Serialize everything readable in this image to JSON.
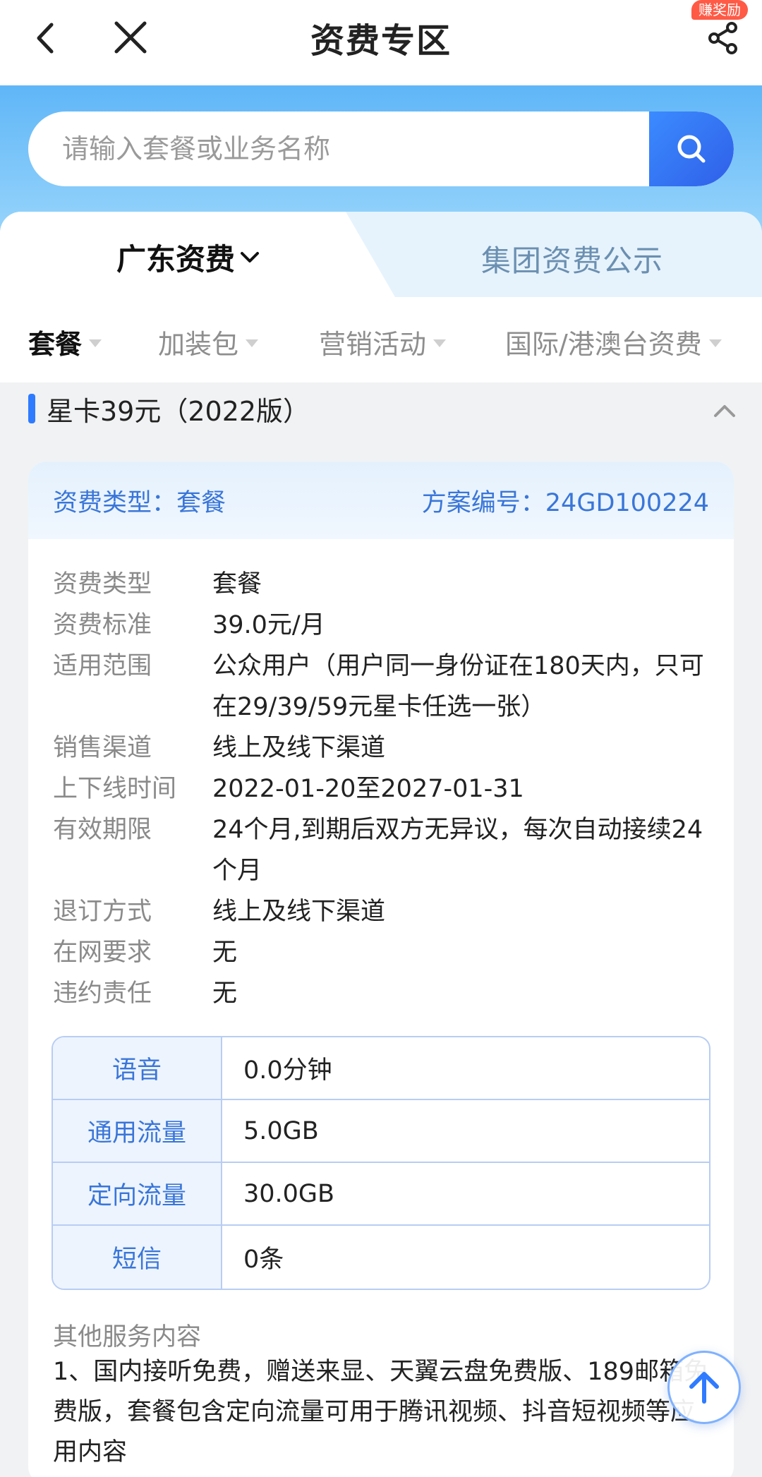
{
  "nav": {
    "title": "资费专区",
    "reward_badge": "赚奖励",
    "icons": [
      "back-arrow-icon",
      "close-icon",
      "share-icon"
    ]
  },
  "search": {
    "placeholder": "请输入套餐或业务名称",
    "icon": "search-icon",
    "accent": "#2f5fe8"
  },
  "region_tabs": [
    {
      "label": "广东资费",
      "active": true
    },
    {
      "label": "集团资费公示",
      "active": false
    }
  ],
  "category_tabs": [
    {
      "label": "套餐",
      "active": true
    },
    {
      "label": "加装包",
      "active": false
    },
    {
      "label": "营销活动",
      "active": false
    },
    {
      "label": "国际/港澳台资费",
      "active": false
    }
  ],
  "section": {
    "title": "星卡39元（2022版）",
    "expanded": true
  },
  "card": {
    "type_label": "资费类型：套餐",
    "code_label": "方案编号：24GD100224",
    "info": [
      {
        "label": "资费类型",
        "value": "套餐"
      },
      {
        "label": "资费标准",
        "value": "39.0元/月"
      },
      {
        "label": "适用范围",
        "value": "公众用户（用户同一身份证在180天内，只可在29/39/59元星卡任选一张）"
      },
      {
        "label": "销售渠道",
        "value": "线上及线下渠道"
      },
      {
        "label": "上下线时间",
        "value": "2022-01-20至2027-01-31"
      },
      {
        "label": "有效期限",
        "value": "24个月,到期后双方无异议，每次自动接续24个月"
      },
      {
        "label": "退订方式",
        "value": "线上及线下渠道"
      },
      {
        "label": "在网要求",
        "value": "无"
      },
      {
        "label": "违约责任",
        "value": "无"
      }
    ],
    "specs": [
      {
        "key": "语音",
        "value": "0.0分钟"
      },
      {
        "key": "通用流量",
        "value": "5.0GB"
      },
      {
        "key": "定向流量",
        "value": "30.0GB"
      },
      {
        "key": "短信",
        "value": "0条"
      }
    ],
    "other_label": "其他服务内容",
    "other_text": "1、国内接听免费，赠送来显、天翼云盘免费版、189邮箱免费版，套餐包含定向流量可用于腾讯视频、抖音短视频等应用内容"
  },
  "back_to_top": "arrow-up-icon"
}
